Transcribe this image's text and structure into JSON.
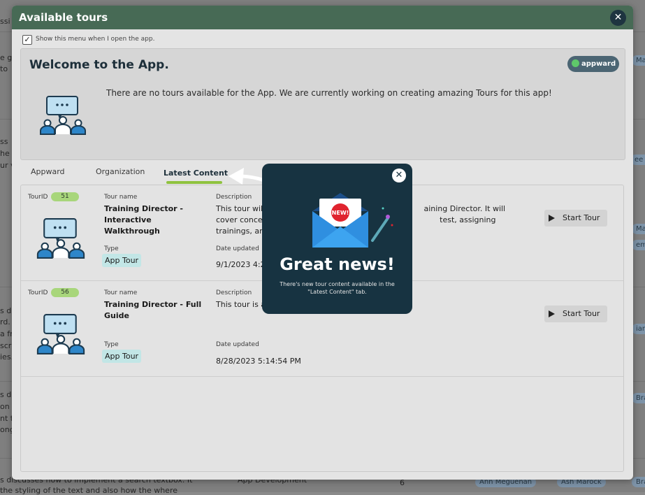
{
  "background_app": {
    "snippets": [
      "ssi",
      "e go",
      "to",
      "ss",
      "he",
      "ur vi",
      "s dis",
      "rd.",
      "a fr",
      "scri",
      "ies.",
      "s dis",
      "on c",
      "nt t",
      "ong",
      "s discusses how to implement a search textbox. It",
      "the styling of the text and also how the where",
      "App Development",
      "6",
      "Ma",
      "ee T",
      "Ma",
      "emij",
      "ian",
      "Bra",
      "Bra",
      "Ann Meguenan",
      "Ash Marock"
    ]
  },
  "dialog": {
    "title": "Available tours",
    "close_icon": "close-icon",
    "show_menu_label": "Show this menu when I open the app.",
    "show_menu_checked": true,
    "welcome": {
      "title": "Welcome to the App.",
      "badge": "appward",
      "message": "There are no tours available for the  App. We are currently working on creating amazing Tours for this app!"
    },
    "tabs": [
      {
        "label": "Appward",
        "active": false
      },
      {
        "label": "Organization",
        "active": false
      },
      {
        "label": "Latest Content",
        "active": true
      }
    ],
    "labels": {
      "tourid": "TourID",
      "tour_name": "Tour name",
      "description": "Description",
      "type": "Type",
      "date_updated": "Date updated",
      "start_tour": "Start Tour"
    },
    "tours": [
      {
        "id": "51",
        "name": "Training Director - Interactive Walkthrough",
        "description": "This tour will                                                                 aining Director. It will cover concepts su                                                               test, assigning trainings, and more.",
        "type": "App Tour",
        "date": "9/1/2023 4:2"
      },
      {
        "id": "56",
        "name": "Training Director - Full Guide",
        "description": "This tour is a",
        "type": "App Tour",
        "date": "8/28/2023 5:14:54 PM"
      }
    ]
  },
  "popup": {
    "badge_text": "NEW!",
    "title": "Great news!",
    "subtitle": "There's new tour content available in the \"Latest Content\" tab.",
    "colors": {
      "bg": "#173341",
      "accent": "#e0242f",
      "envelope": "#2f8fe0"
    }
  }
}
